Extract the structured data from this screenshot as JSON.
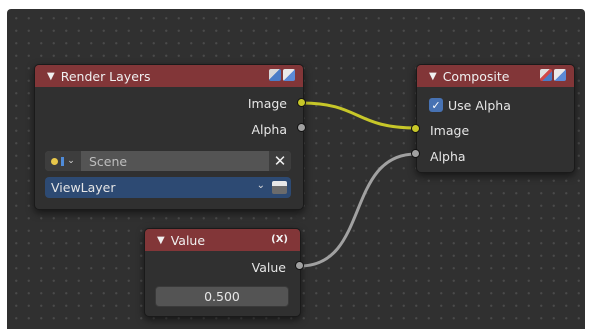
{
  "colors": {
    "background": "#303030",
    "grid_dot": "#4a4a4a",
    "node_header": "#823638",
    "node_body": "#303030",
    "socket_color": "#c7c729",
    "socket_float": "#a1a1a1",
    "link_color": "#a1a1a1",
    "link_color_image": "#c7c729",
    "checkbox_blue": "#4772b3",
    "viewlayer_field": "#2d4a73"
  },
  "nodes": {
    "render_layers": {
      "title": "Render Layers",
      "header_icons": [
        "render-preview-icon",
        "render-layer-icon"
      ],
      "outputs": [
        {
          "label": "Image",
          "socket": "color"
        },
        {
          "label": "Alpha",
          "socket": "float"
        }
      ],
      "scene_selector": {
        "icon": "scene-icon",
        "value": "Scene",
        "clear_icon": "close-icon"
      },
      "view_layer_selector": {
        "value": "ViewLayer",
        "icon": "view-layer-icon"
      }
    },
    "composite": {
      "title": "Composite",
      "header_icons": [
        "backdrop-icon",
        "render-layer-icon"
      ],
      "use_alpha": {
        "label": "Use Alpha",
        "checked": true
      },
      "inputs": [
        {
          "label": "Image",
          "socket": "color"
        },
        {
          "label": "Alpha",
          "socket": "float"
        }
      ]
    },
    "value": {
      "title": "Value",
      "header_right": "(X)",
      "outputs": [
        {
          "label": "Value",
          "socket": "float"
        }
      ],
      "field_value": "0.500"
    }
  }
}
